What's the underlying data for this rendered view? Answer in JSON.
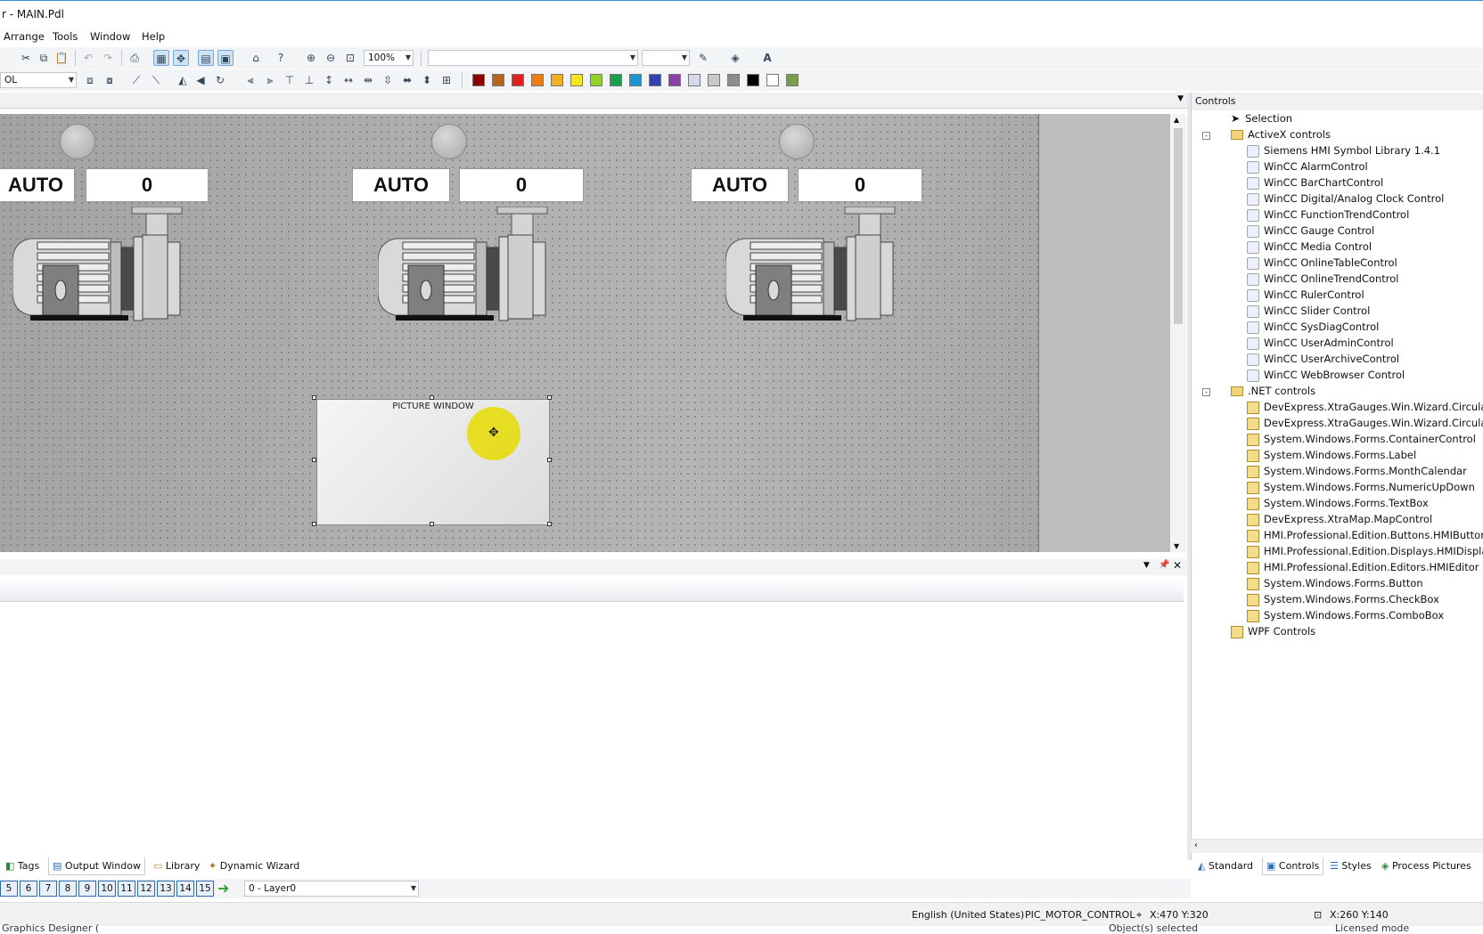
{
  "title": "r - MAIN.Pdl",
  "menu": [
    "Arrange",
    "Tools",
    "Window",
    "Help"
  ],
  "toolbar": {
    "zoom": "100%",
    "object_combo": "OL"
  },
  "palette": [
    "#8b0000",
    "#b5651d",
    "#e0201c",
    "#f07c14",
    "#f0b020",
    "#f7e61a",
    "#94d22b",
    "#1aa04a",
    "#1c95d0",
    "#3040b0",
    "#8c3fa8",
    "#d8d8ec",
    "#c8c8c8",
    "#8c8c8c",
    "#000000",
    "#ffffff",
    "#7b9e4b"
  ],
  "canvas": {
    "units": [
      {
        "mode": "AUTO",
        "value": "0"
      },
      {
        "mode": "AUTO",
        "value": "0"
      },
      {
        "mode": "AUTO",
        "value": "0"
      }
    ],
    "picture_window_label": "PICTURE WINDOW"
  },
  "controls_panel": {
    "title": "Controls",
    "items": [
      {
        "label": "Selection",
        "kind": "pointer",
        "level": 1
      },
      {
        "label": "ActiveX controls",
        "kind": "folder",
        "level": 1,
        "expander": "-"
      },
      {
        "label": "Siemens HMI Symbol Library 1.4.1",
        "kind": "icon",
        "level": 2
      },
      {
        "label": "WinCC AlarmControl",
        "kind": "icon",
        "level": 2
      },
      {
        "label": "WinCC BarChartControl",
        "kind": "icon",
        "level": 2
      },
      {
        "label": "WinCC Digital/Analog Clock Control",
        "kind": "icon",
        "level": 2
      },
      {
        "label": "WinCC FunctionTrendControl",
        "kind": "icon",
        "level": 2
      },
      {
        "label": "WinCC Gauge Control",
        "kind": "icon",
        "level": 2
      },
      {
        "label": "WinCC Media Control",
        "kind": "icon",
        "level": 2
      },
      {
        "label": "WinCC OnlineTableControl",
        "kind": "icon",
        "level": 2
      },
      {
        "label": "WinCC OnlineTrendControl",
        "kind": "icon",
        "level": 2
      },
      {
        "label": "WinCC RulerControl",
        "kind": "icon",
        "level": 2
      },
      {
        "label": "WinCC Slider Control",
        "kind": "icon",
        "level": 2
      },
      {
        "label": "WinCC SysDiagControl",
        "kind": "icon",
        "level": 2
      },
      {
        "label": "WinCC UserAdminControl",
        "kind": "icon",
        "level": 2
      },
      {
        "label": "WinCC UserArchiveControl",
        "kind": "icon",
        "level": 2
      },
      {
        "label": "WinCC WebBrowser Control",
        "kind": "icon",
        "level": 2
      },
      {
        "label": ".NET controls",
        "kind": "folder",
        "level": 1,
        "expander": "-"
      },
      {
        "label": "DevExpress.XtraGauges.Win.Wizard.CircularGauge",
        "kind": "net",
        "level": 2
      },
      {
        "label": "DevExpress.XtraGauges.Win.Wizard.CircularGauge",
        "kind": "net",
        "level": 2
      },
      {
        "label": "System.Windows.Forms.ContainerControl",
        "kind": "net",
        "level": 2
      },
      {
        "label": "System.Windows.Forms.Label",
        "kind": "net",
        "level": 2
      },
      {
        "label": "System.Windows.Forms.MonthCalendar",
        "kind": "net",
        "level": 2
      },
      {
        "label": "System.Windows.Forms.NumericUpDown",
        "kind": "net",
        "level": 2
      },
      {
        "label": "System.Windows.Forms.TextBox",
        "kind": "net",
        "level": 2
      },
      {
        "label": "DevExpress.XtraMap.MapControl",
        "kind": "net",
        "level": 2
      },
      {
        "label": "HMI.Professional.Edition.Buttons.HMIButton",
        "kind": "net",
        "level": 2
      },
      {
        "label": "HMI.Professional.Edition.Displays.HMIDisplay",
        "kind": "net",
        "level": 2
      },
      {
        "label": "HMI.Professional.Edition.Editors.HMIEditor",
        "kind": "net",
        "level": 2
      },
      {
        "label": "System.Windows.Forms.Button",
        "kind": "net",
        "level": 2
      },
      {
        "label": "System.Windows.Forms.CheckBox",
        "kind": "net",
        "level": 2
      },
      {
        "label": "System.Windows.Forms.ComboBox",
        "kind": "net",
        "level": 2
      },
      {
        "label": "WPF Controls",
        "kind": "wpf",
        "level": 1
      }
    ]
  },
  "bottom_tabs_left": [
    {
      "label": "Tags",
      "icon": "tags-icon"
    },
    {
      "label": "Output Window",
      "icon": "output-window-icon",
      "active": true
    },
    {
      "label": "Library",
      "icon": "library-icon"
    },
    {
      "label": "Dynamic Wizard",
      "icon": "dynamic-wizard-icon"
    }
  ],
  "bottom_tabs_right": [
    {
      "label": "Standard",
      "icon": "standard-icon"
    },
    {
      "label": "Controls",
      "icon": "controls-icon",
      "active": true
    },
    {
      "label": "Styles",
      "icon": "styles-icon"
    },
    {
      "label": "Process Pictures",
      "icon": "process-pictures-icon"
    }
  ],
  "layers": {
    "buttons": [
      "5",
      "6",
      "7",
      "8",
      "9",
      "10",
      "11",
      "12",
      "13",
      "14",
      "15"
    ],
    "current": "0 - Layer0"
  },
  "status": {
    "language": "English (United States)",
    "object": "PIC_MOTOR_CONTROL",
    "position": "X:470 Y:320",
    "size": "X:260 Y:140",
    "left_clip": "Graphics Designer (",
    "mid_clip": "Object(s) selected",
    "right_clip": "Licensed mode"
  }
}
